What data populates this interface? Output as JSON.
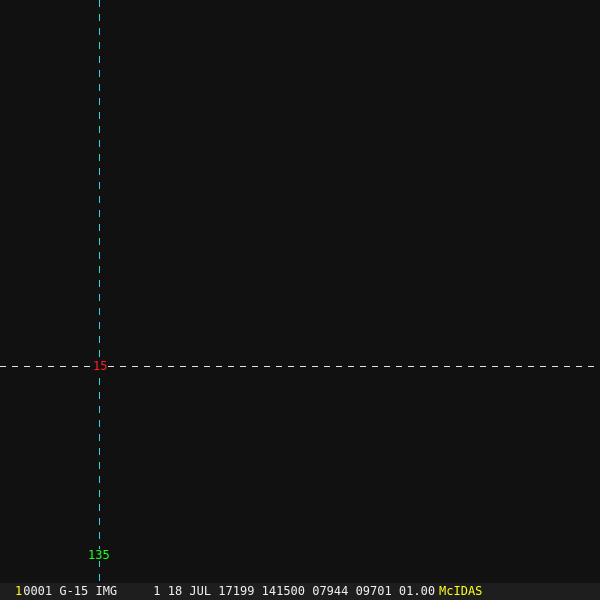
{
  "overlay": {
    "latitude_label": "15",
    "longitude_label": "135"
  },
  "status_bar": {
    "frame_number": "1",
    "text": "0001 G-15 IMG     1 18 JUL 17199 141500 07944 09701 01.00",
    "brand": "McIDAS"
  },
  "colors": {
    "grid_line": "#2fd6e6",
    "lat_label": "#ff2020",
    "lon_label": "#20ff20",
    "brand": "#ffff20"
  }
}
